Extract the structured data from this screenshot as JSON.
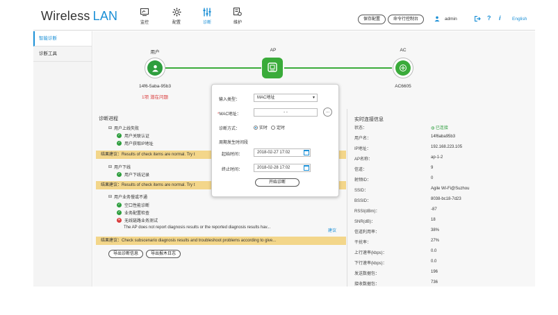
{
  "header": {
    "brand_main": "Wireless",
    "brand_accent": "LAN",
    "nav": [
      {
        "label": "监控",
        "icon": "monitor-icon"
      },
      {
        "label": "配置",
        "icon": "gear-icon"
      },
      {
        "label": "诊断",
        "icon": "sliders-icon"
      },
      {
        "label": "维护",
        "icon": "wrench-icon"
      }
    ],
    "save_config": "保存配置",
    "cli": "命令行控制台",
    "user": "admin",
    "language": "English"
  },
  "sidebar": {
    "items": [
      {
        "label": "智能诊断"
      },
      {
        "label": "诊断工具"
      }
    ]
  },
  "topology": {
    "user_label": "用户",
    "ap_label": "AP",
    "ac_label": "AC",
    "user_mac": "14f6-5aba-95b3",
    "ac_name": "AC6605",
    "issue": "1项 潜在问题"
  },
  "progress": {
    "title": "诊断进程",
    "g1": "用户上线失败",
    "g1_items": [
      "用户关联认证",
      "用户获取IP地址"
    ],
    "banner1": "结果建议：Results of check items are normal. Try t",
    "g2": "用户下线",
    "g2_items": [
      "用户下线记录"
    ],
    "banner2": "结果建议：Results of check items are normal. Try t",
    "g3": "用户业务慢或不通",
    "g3_items": [
      "空口性能诊断",
      "业务配置检查"
    ],
    "g3_bad": "无线链路业务测试",
    "g3_note": "The AP does not report diagnosis results or the reported diagnosis results hav...",
    "g3_link": "建议",
    "banner3": "结果建议：Check subscenario diagnosis results and troubleshoot problems according to give...",
    "export_result": "导出诊断信息",
    "export_log": "导出报木日志"
  },
  "realtime": {
    "title": "实时连接信息",
    "rows": [
      {
        "k": "状态：",
        "v": "已连接"
      },
      {
        "k": "用户名：",
        "v": "14f6aba95b3"
      },
      {
        "k": "IP地址：",
        "v": "192.168.223.105"
      },
      {
        "k": "AP名称：",
        "v": "ap-1-2"
      },
      {
        "k": "信道：",
        "v": "9"
      },
      {
        "k": "射频ID：",
        "v": "0"
      },
      {
        "k": "SSID：",
        "v": "Agile Wi-Fi@Suzhou"
      },
      {
        "k": "BSSID：",
        "v": "8038-bc18-7d23"
      },
      {
        "k": "RSSI(dBm)：",
        "v": "-87"
      },
      {
        "k": "SNR(dB)：",
        "v": "18"
      },
      {
        "k": "信道利用率：",
        "v": "38%"
      },
      {
        "k": "干扰率：",
        "v": "27%"
      },
      {
        "k": "上行速率(kbps)：",
        "v": "0.0"
      },
      {
        "k": "下行速率(kbps)：",
        "v": "0.0"
      },
      {
        "k": "发送数据包：",
        "v": "196"
      },
      {
        "k": "接收数据包：",
        "v": "736"
      }
    ]
  },
  "modal": {
    "input_type_label": "输入类型：",
    "input_type_value": "MAC地址",
    "mac_label": "MAC地址：",
    "mac_value": "-     -",
    "mode_label": "诊断方式：",
    "mode_opt1": "实时",
    "mode_opt2": "定时",
    "period_title": "周期发生时间段",
    "start_label": "起始时间：",
    "start_value": "2018-02-27 17:02",
    "end_label": "终止时间：",
    "end_value": "2018-02-28 17:02",
    "start_button": "开始诊断"
  },
  "colors": {
    "accent": "#1a8fd6",
    "ok": "#2e9e3e",
    "ap": "#3aab3a",
    "banner": "#f3d68a",
    "error": "#d93b3b"
  }
}
